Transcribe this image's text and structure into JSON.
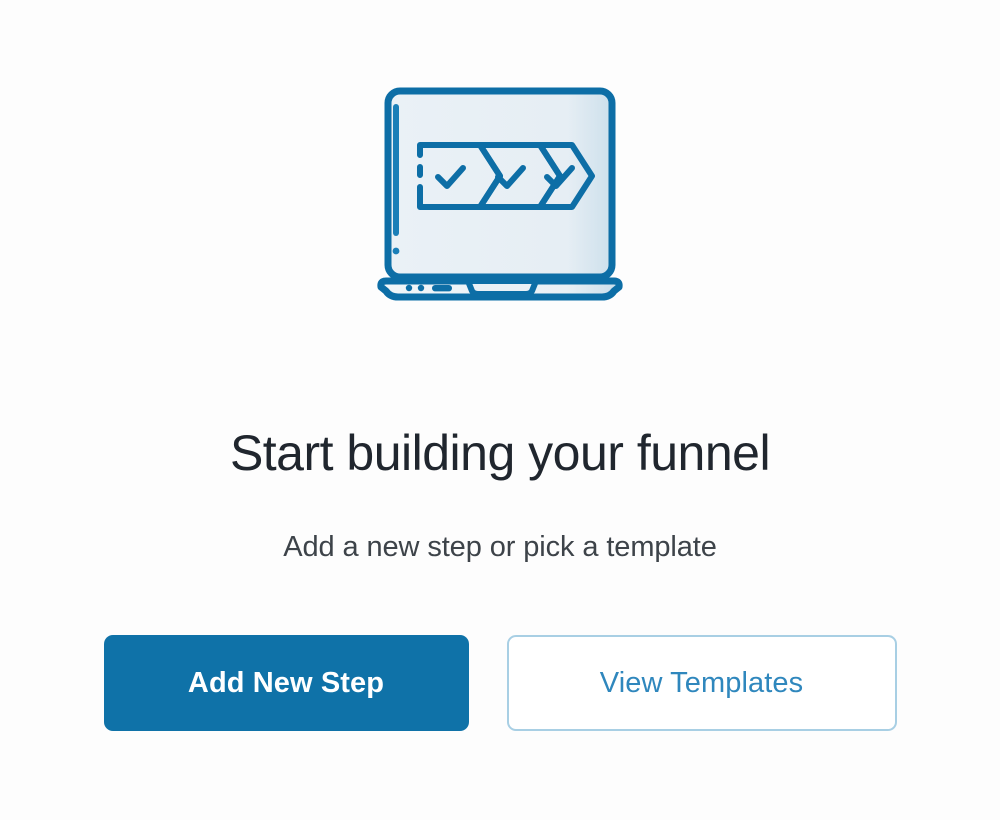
{
  "page": {
    "background_color": "#fdfdfd"
  },
  "illustration": {
    "name": "funnel-builder-laptop-illustration",
    "description": "Laptop screen showing three chevron funnel steps each with a checkmark",
    "outline_color": "#0d6ea6",
    "screen_fill_color": "#e8eff4",
    "accent_color": "#1a7fb8",
    "step_count": 3,
    "step_marker": "check"
  },
  "headline": {
    "text": "Start building your funnel",
    "color": "#20262e"
  },
  "subhead": {
    "text": "Add a new step or pick a template",
    "color": "#3d4349"
  },
  "actions": {
    "primary": {
      "label": "Add New Step",
      "background_color": "#0f72a8",
      "text_color": "#ffffff"
    },
    "secondary": {
      "label": "View Templates",
      "background_color": "#ffffff",
      "border_color": "#a8cfe4",
      "text_color": "#2f87bd"
    }
  }
}
